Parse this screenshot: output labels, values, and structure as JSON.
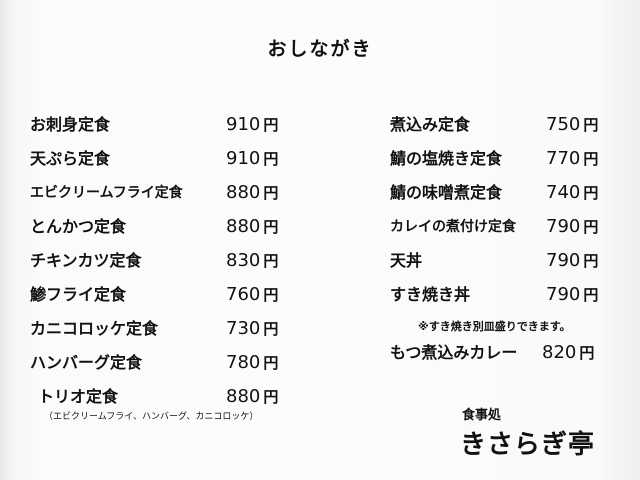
{
  "title": "おしながき",
  "left_items": [
    {
      "name": "お刺身定食",
      "price": "910",
      "unit": "円"
    },
    {
      "name": "天ぷら定食",
      "price": "910",
      "unit": "円"
    },
    {
      "name": "エビクリームフライ定食",
      "price": "880",
      "unit": "円"
    },
    {
      "name": "とんかつ定食",
      "price": "880",
      "unit": "円"
    },
    {
      "name": "チキンカツ定食",
      "price": "830",
      "unit": "円"
    },
    {
      "name": "鯵フライ定食",
      "price": "760",
      "unit": "円"
    },
    {
      "name": "カニコロッケ定食",
      "price": "730",
      "unit": "円"
    },
    {
      "name": "ハンバーグ定食",
      "price": "780",
      "unit": "円"
    },
    {
      "name": "トリオ定食",
      "price": "880",
      "unit": "円"
    }
  ],
  "trio_note": "（エビクリームフライ、ハンバーグ、カニコロッケ）",
  "right_items": [
    {
      "name": "煮込み定食",
      "price": "750",
      "unit": "円"
    },
    {
      "name": "鯖の塩焼き定食",
      "price": "770",
      "unit": "円"
    },
    {
      "name": "鯖の味噌煮定食",
      "price": "740",
      "unit": "円"
    },
    {
      "name": "カレイの煮付け定食",
      "price": "790",
      "unit": "円"
    },
    {
      "name": "天丼",
      "price": "790",
      "unit": "円"
    },
    {
      "name": "すき焼き丼",
      "price": "790",
      "unit": "円"
    }
  ],
  "sukiyaki_note": "※すき焼き別皿盛りできます。",
  "extra_item": {
    "name": "もつ煮込みカレー",
    "price": "820",
    "unit": "円"
  },
  "shop": {
    "sub": "食事処",
    "name": "きさらぎ亭"
  }
}
